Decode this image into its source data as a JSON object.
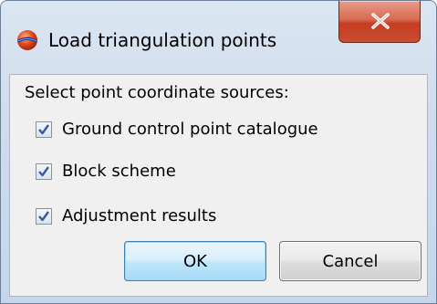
{
  "window": {
    "title": "Load triangulation points",
    "icon": "app-sphere-icon",
    "close_icon": "close-icon"
  },
  "dialog": {
    "prompt": "Select point coordinate sources:",
    "options": [
      {
        "label": "Ground control point catalogue",
        "checked": true
      },
      {
        "label": "Block scheme",
        "checked": true
      },
      {
        "label": "Adjustment results",
        "checked": true
      }
    ],
    "ok_label": "OK",
    "cancel_label": "Cancel"
  },
  "colors": {
    "close_button": "#c94d31",
    "ok_button_border": "#3c7fb1",
    "check_mark": "#3a5a9a"
  }
}
